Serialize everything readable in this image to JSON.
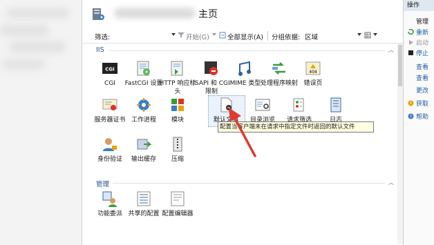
{
  "header": {
    "title": "主页"
  },
  "toolbar": {
    "filter_label": "筛选:",
    "start_label": "开始(G)",
    "show_all_label": "全部显示(A)",
    "group_by_label": "分组依据:",
    "group_by_value": "区域"
  },
  "sections": [
    {
      "name": "IIS"
    },
    {
      "name": "管理"
    }
  ],
  "features": [
    {
      "label": "CGI",
      "icon": "cgi-icon"
    },
    {
      "label": "FastCGI 设置",
      "icon": "fastcgi-icon"
    },
    {
      "label": "HTTP 响应标头",
      "icon": "http-headers-icon"
    },
    {
      "label": "ISAPI 和 CGI 限制",
      "icon": "isapi-icon"
    },
    {
      "label": "MIME 类型",
      "icon": "mime-icon"
    },
    {
      "label": "处理程序映射",
      "icon": "handler-icon"
    },
    {
      "label": "错误页",
      "icon": "error-page-icon"
    },
    {
      "label": "服务器证书",
      "icon": "certificate-icon"
    },
    {
      "label": "工作进程",
      "icon": "worker-process-icon"
    },
    {
      "label": "模块",
      "icon": "modules-icon"
    },
    {
      "label": "默认文档",
      "icon": "default-document-icon"
    },
    {
      "label": "目录浏览",
      "icon": "directory-browsing-icon"
    },
    {
      "label": "请求筛选",
      "icon": "request-filtering-icon"
    },
    {
      "label": "日志",
      "icon": "logging-icon"
    },
    {
      "label": "身份验证",
      "icon": "authentication-icon"
    },
    {
      "label": "输出缓存",
      "icon": "output-cache-icon"
    },
    {
      "label": "压缩",
      "icon": "compression-icon"
    },
    {
      "label": "功能委派",
      "icon": "feature-delegation-icon"
    },
    {
      "label": "共享的配置",
      "icon": "shared-config-icon"
    },
    {
      "label": "配置编辑器",
      "icon": "config-editor-icon"
    }
  ],
  "tooltip": "配置当客户端未在请求中指定文件时返回的默认文件",
  "actions": {
    "title": "操作",
    "items": [
      {
        "label": "管理",
        "style": "blk"
      },
      {
        "label": "重新",
        "style": "link"
      },
      {
        "label": "启动",
        "style": "dis"
      },
      {
        "label": "停止",
        "style": "link"
      },
      {
        "label": "查看",
        "style": "link"
      },
      {
        "label": "查看",
        "style": "link"
      },
      {
        "label": "更改",
        "style": "link"
      },
      {
        "label": "获取",
        "style": "link"
      },
      {
        "label": "帮助",
        "style": "link"
      }
    ]
  },
  "colors": {
    "link": "#1f5fa8",
    "section": "#1e4e8c",
    "tooltip_bg": "#ffffe1",
    "arrow": "#e03a2f"
  }
}
